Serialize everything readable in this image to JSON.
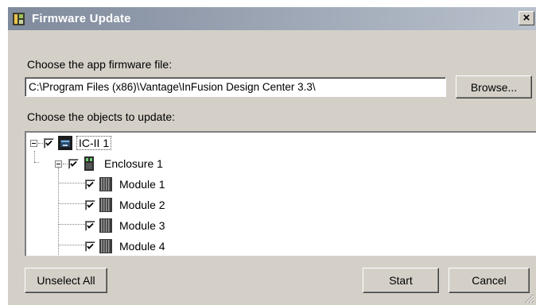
{
  "window": {
    "title": "Firmware Update",
    "close_symbol": "×"
  },
  "firmware": {
    "label": "Choose the app firmware file:",
    "path_value": "C:\\Program Files (x86)\\Vantage\\InFusion Design Center 3.3\\",
    "browse_label": "Browse..."
  },
  "objects": {
    "label": "Choose the objects to update:",
    "tree": {
      "root": {
        "label": "IC-II 1",
        "checked": true,
        "icon": "controller-icon"
      },
      "enclosure": {
        "label": "Enclosure 1",
        "checked": true,
        "icon": "enclosure-icon"
      },
      "modules": [
        {
          "label": "Module 1",
          "checked": true,
          "icon": "module-icon"
        },
        {
          "label": "Module 2",
          "checked": true,
          "icon": "module-icon"
        },
        {
          "label": "Module 3",
          "checked": true,
          "icon": "module-icon"
        },
        {
          "label": "Module 4",
          "checked": true,
          "icon": "module-icon"
        }
      ]
    }
  },
  "buttons": {
    "unselect_all": "Unselect All",
    "start": "Start",
    "cancel": "Cancel"
  },
  "colors": {
    "window_bg": "#d4d0c8",
    "title_gradient_start": "#7f8a9c",
    "title_gradient_end": "#b9c1cc"
  }
}
